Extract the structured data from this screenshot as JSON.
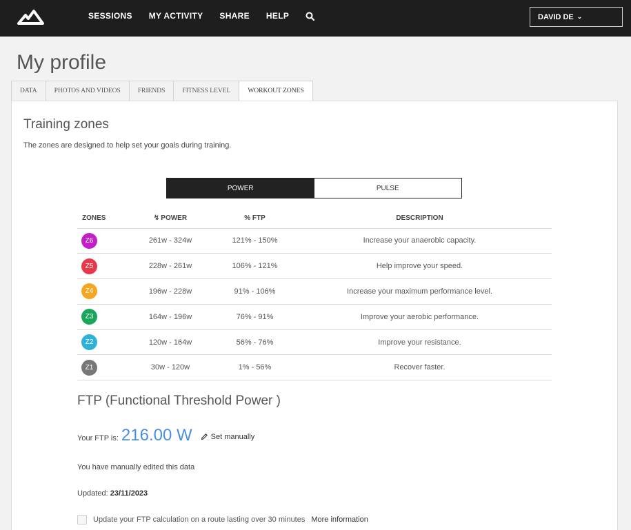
{
  "nav": {
    "logo_icon": "mountain-logo-icon",
    "items": [
      "SESSIONS",
      "MY ACTIVITY",
      "SHARE",
      "HELP"
    ],
    "search_icon": "search-icon",
    "user": "DAVID DE"
  },
  "page_title": "My profile",
  "tabs": [
    {
      "label": "DATA",
      "active": false
    },
    {
      "label": "PHOTOS AND VIDEOS",
      "active": false
    },
    {
      "label": "FRIENDS",
      "active": false
    },
    {
      "label": "FITNESS LEVEL",
      "active": false
    },
    {
      "label": "WORKOUT ZONES",
      "active": true
    }
  ],
  "training": {
    "title": "Training zones",
    "description": "The zones are designed to help set your goals during training."
  },
  "toggle": {
    "options": [
      "POWER",
      "PULSE"
    ],
    "selected": "POWER"
  },
  "table": {
    "headers": {
      "zones": "ZONES",
      "power": "POWER",
      "ftp": "% FTP",
      "description": "DESCRIPTION"
    },
    "rows": [
      {
        "zone": "Z6",
        "color": "#c21fc9",
        "power": "261w - 324w",
        "ftp": "121% - 150%",
        "description": "Increase your anaerobic capacity."
      },
      {
        "zone": "Z5",
        "color": "#e8394a",
        "power": "228w - 261w",
        "ftp": "106% - 121%",
        "description": "Help improve your speed."
      },
      {
        "zone": "Z4",
        "color": "#f5a623",
        "power": "196w - 228w",
        "ftp": "91% - 106%",
        "description": "Increase your maximum performance level."
      },
      {
        "zone": "Z3",
        "color": "#1aa65a",
        "power": "164w - 196w",
        "ftp": "76% - 91%",
        "description": "Improve your aerobic performance."
      },
      {
        "zone": "Z2",
        "color": "#2fb0d6",
        "power": "120w - 164w",
        "ftp": "56% - 76%",
        "description": "Improve your resistance."
      },
      {
        "zone": "Z1",
        "color": "#777777",
        "power": "30w - 120w",
        "ftp": "1% - 56%",
        "description": "Recover faster."
      }
    ]
  },
  "ftp": {
    "title": "FTP (Functional Threshold Power )",
    "label": "Your FTP is:",
    "value": "216.00 W",
    "set_manually": "Set manually",
    "edited_note": "You have manually edited this data",
    "updated_label": "Updated:",
    "updated_date": "23/11/2023",
    "update_checkbox_label": "Update your FTP calculation on a route lasting over 30 minutes",
    "update_checked": false,
    "more_info": "More information"
  }
}
